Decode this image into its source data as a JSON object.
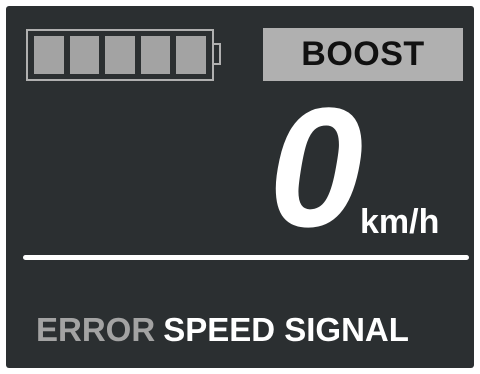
{
  "display": {
    "background_color": "#2b2f31",
    "accent_color": "#ffffff",
    "dim_color": "#a3a3a3"
  },
  "battery": {
    "icon": "battery-icon",
    "segments_filled": 5,
    "segments_total": 5
  },
  "mode": {
    "label": "BOOST"
  },
  "speed": {
    "value": "0",
    "unit": "km/h"
  },
  "status": {
    "label": "ERROR",
    "message": "SPEED SIGNAL"
  }
}
